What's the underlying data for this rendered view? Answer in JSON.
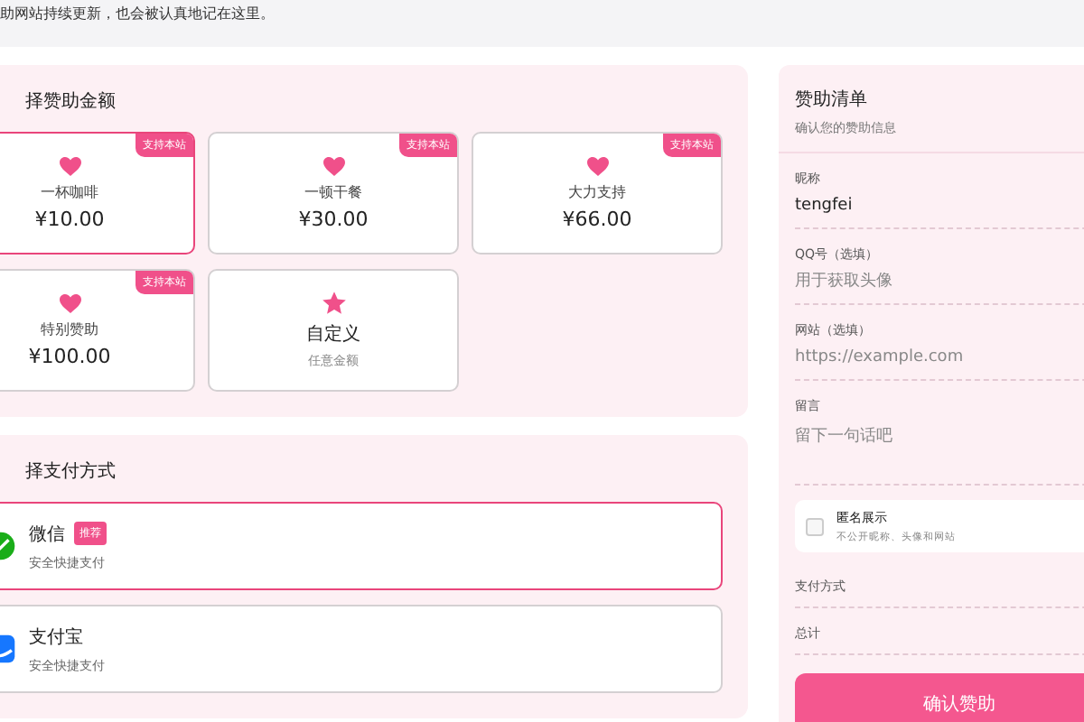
{
  "notice": "助网站持续更新，也会被认真地记在这里。",
  "amount_section": {
    "title": "择赞助金额",
    "cards": [
      {
        "kind": "preset",
        "name": "一杯咖啡",
        "price": "¥10.00",
        "badge": "支持本站",
        "selected": true
      },
      {
        "kind": "preset",
        "name": "一顿干餐",
        "price": "¥30.00",
        "badge": "支持本站",
        "selected": false
      },
      {
        "kind": "preset",
        "name": "大力支持",
        "price": "¥66.00",
        "badge": "支持本站",
        "selected": false
      },
      {
        "kind": "preset",
        "name": "特别赞助",
        "price": "¥100.00",
        "badge": "支持本站",
        "selected": false
      },
      {
        "kind": "custom",
        "name": "自定义",
        "subtitle": "任意金额",
        "selected": false
      }
    ]
  },
  "payment_section": {
    "title": "择支付方式",
    "options": [
      {
        "kind": "wechat",
        "name": "微信",
        "badge": "推荐",
        "subtitle": "安全快捷支付",
        "selected": true
      },
      {
        "kind": "alipay",
        "name": "支付宝",
        "subtitle": "安全快捷支付",
        "selected": false
      }
    ]
  },
  "summary": {
    "title": "赞助清单",
    "subtitle": "确认您的赞助信息",
    "fields": [
      {
        "label": "昵称",
        "value": "tengfei"
      },
      {
        "label": "QQ号（选填）",
        "placeholder": "用于获取头像"
      },
      {
        "label": "网站（选填）",
        "placeholder": "https://example.com"
      },
      {
        "label": "留言",
        "placeholder": "留下一句话吧",
        "multiline": true
      }
    ],
    "anonymous": {
      "title": "匿名展示",
      "subtitle": "不公开昵称、头像和网站",
      "checked": false
    },
    "rows": [
      "支付方式",
      "总计"
    ],
    "submit": "确认赞助"
  }
}
